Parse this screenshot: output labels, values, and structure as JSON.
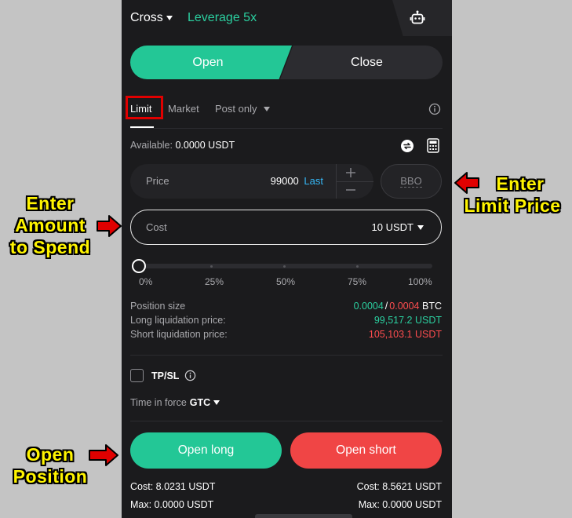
{
  "header": {
    "margin_mode": "Cross",
    "leverage": "Leverage 5x"
  },
  "side_tabs": {
    "open": "Open",
    "close": "Close"
  },
  "order_types": {
    "limit": "Limit",
    "market": "Market",
    "post_only": "Post only"
  },
  "available": {
    "label": "Available:",
    "value": "0.0000 USDT"
  },
  "price": {
    "label": "Price",
    "value": "99000",
    "last": "Last",
    "bbo": "BBO"
  },
  "cost": {
    "label": "Cost",
    "value": "10 USDT"
  },
  "slider": {
    "level_percent": 0,
    "ticks": [
      "0%",
      "25%",
      "50%",
      "75%",
      "100%"
    ]
  },
  "stats": {
    "position_size_label": "Position size",
    "position_size_long": "0.0004",
    "position_size_sep": "/",
    "position_size_short": "0.0004",
    "position_size_unit": "BTC",
    "long_liq_label": "Long liquidation price:",
    "long_liq_value": "99,517.2 USDT",
    "short_liq_label": "Short liquidation price:",
    "short_liq_value": "105,103.1 USDT"
  },
  "tpsl": {
    "label": "TP/SL"
  },
  "time_in_force": {
    "label": "Time in force",
    "value": "GTC"
  },
  "actions": {
    "open_long": "Open long",
    "open_short": "Open short"
  },
  "footer": {
    "cost_long": "Cost: 8.0231 USDT",
    "max_long": "Max: 0.0000 USDT",
    "cost_short": "Cost: 8.5621 USDT",
    "max_short": "Max: 0.0000 USDT"
  },
  "callouts": {
    "amount": [
      "Enter",
      "Amount",
      "to Spend"
    ],
    "price": [
      "Enter",
      "Limit Price"
    ],
    "open": [
      "Open",
      "Position"
    ]
  },
  "colors": {
    "green": "#23c796",
    "red": "#f04545",
    "highlight": "#e00000",
    "callout_text": "#fff400"
  }
}
